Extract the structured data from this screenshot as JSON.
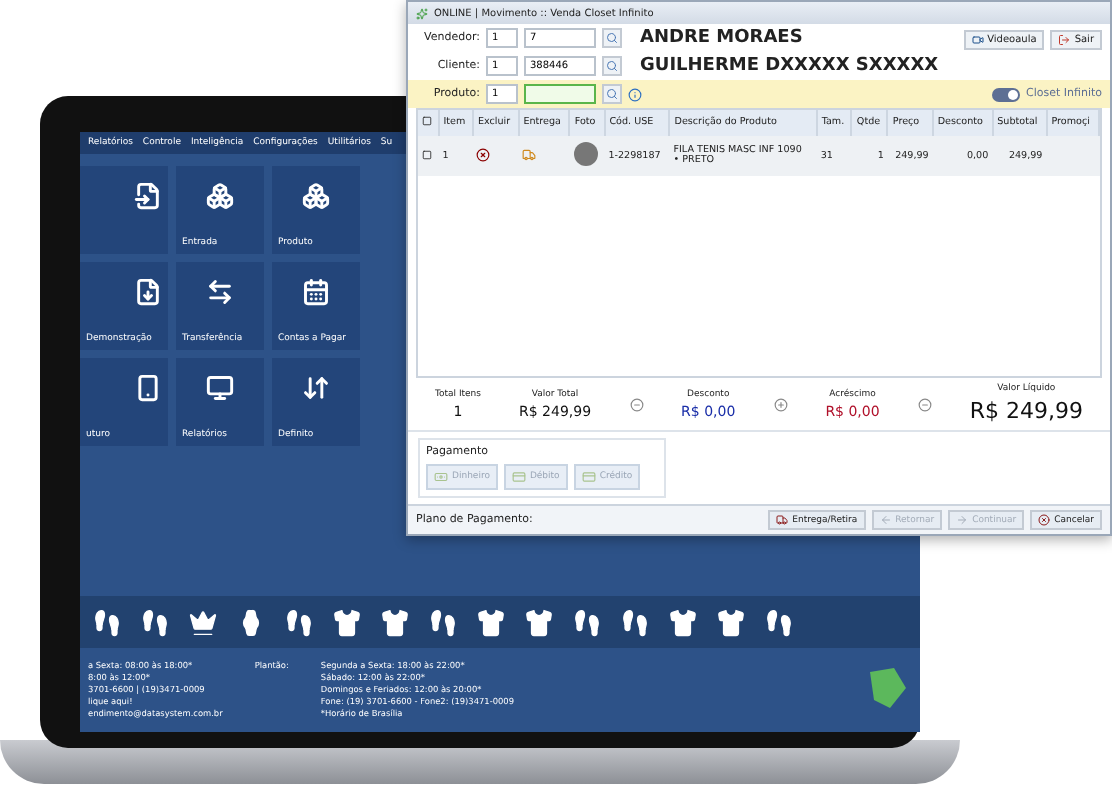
{
  "desktop": {
    "menu": [
      "Relatórios",
      "Controle",
      "Inteligência",
      "Configurações",
      "Utilitários",
      "Su"
    ],
    "tiles": [
      {
        "kind": "partial"
      },
      {
        "label": "Entrada",
        "kind": "full"
      },
      {
        "label": "Produto",
        "kind": "full"
      },
      {
        "label": "Demonstração",
        "kind": "partial"
      },
      {
        "label": "Transferência",
        "kind": "full"
      },
      {
        "label": "Contas a Pagar",
        "kind": "full"
      },
      {
        "label": "uturo",
        "kind": "partial"
      },
      {
        "label": "Relatórios",
        "kind": "full"
      },
      {
        "label": "Definito",
        "kind": "full"
      }
    ],
    "hours": [
      "a Sexta: 08:00 às 18:00*",
      "8:00 às 12:00*",
      "3701-6600 | (19)3471-0009",
      "lique aqui!",
      "endimento@datasystem.com.br"
    ],
    "oncall_label": "Plantão:",
    "oncall": [
      "Segunda a Sexta: 18:00 às 22:00*",
      "Sábado: 12:00 às 22:00*",
      "Domingos e Feriados: 12:00 às 20:00*",
      "Fone: (19) 3701-6600 - Fone2: (19)3471-0009",
      "*Horário de Brasília"
    ]
  },
  "window": {
    "title": "ONLINE | Movimento :: Venda Closet Infinito",
    "seller": {
      "label": "Vendedor:",
      "code1": "1",
      "code2": "7",
      "name": "ANDRE MORAES"
    },
    "client": {
      "label": "Cliente:",
      "code1": "1",
      "code2": "388446",
      "name": "GUILHERME DXXXXX SXXXXX"
    },
    "product": {
      "label": "Produto:",
      "code1": "1"
    },
    "video_button": "Videoaula",
    "exit_button": "Sair",
    "toggle": {
      "label": "Closet Infinito",
      "on": true
    },
    "table": {
      "columns": [
        "Item",
        "Excluir",
        "Entrega",
        "Foto",
        "Cód. USE",
        "Descrição do Produto",
        "Tam.",
        "Qtde",
        "Preço",
        "Desconto",
        "Subtotal",
        "Promoçi"
      ],
      "rows": [
        {
          "checked": false,
          "item": "1",
          "code": "1-2298187",
          "description": "FILA TENIS MASC INF 1090",
          "variant": "• PRETO",
          "size": "31",
          "qty": "1",
          "price": "249,99",
          "discount": "0,00",
          "subtotal": "249,99"
        }
      ]
    },
    "totals": [
      {
        "label": "Total Itens",
        "value": "1",
        "color": "#111111",
        "op": false
      },
      {
        "label": "Valor Total",
        "value": "R$ 249,99",
        "color": "#111111",
        "op": true
      },
      {
        "label": "Desconto",
        "value": "R$ 0,00",
        "color": "#1a2ea8",
        "op": true
      },
      {
        "label": "Acréscimo",
        "value": "R$ 0,00",
        "color": "#b0102a",
        "op": true
      },
      {
        "label": "Valor Líquido",
        "value": "R$ 249,99",
        "color": "#111111",
        "op": false,
        "big": true
      }
    ],
    "payment": {
      "title": "Pagamento",
      "methods": [
        {
          "label": "Dinheiro",
          "disabled": true
        },
        {
          "label": "Débito",
          "disabled": true
        },
        {
          "label": "Crédito",
          "disabled": true
        }
      ]
    },
    "plan_label": "Plano de Pagamento:",
    "actions": [
      {
        "label": "Entrega/Retira",
        "disabled": false,
        "kind": "deliver"
      },
      {
        "label": "Retornar",
        "disabled": true,
        "kind": "back"
      },
      {
        "label": "Continuar",
        "disabled": true,
        "kind": "next"
      },
      {
        "label": "Cancelar",
        "disabled": false,
        "kind": "cancel"
      }
    ]
  }
}
